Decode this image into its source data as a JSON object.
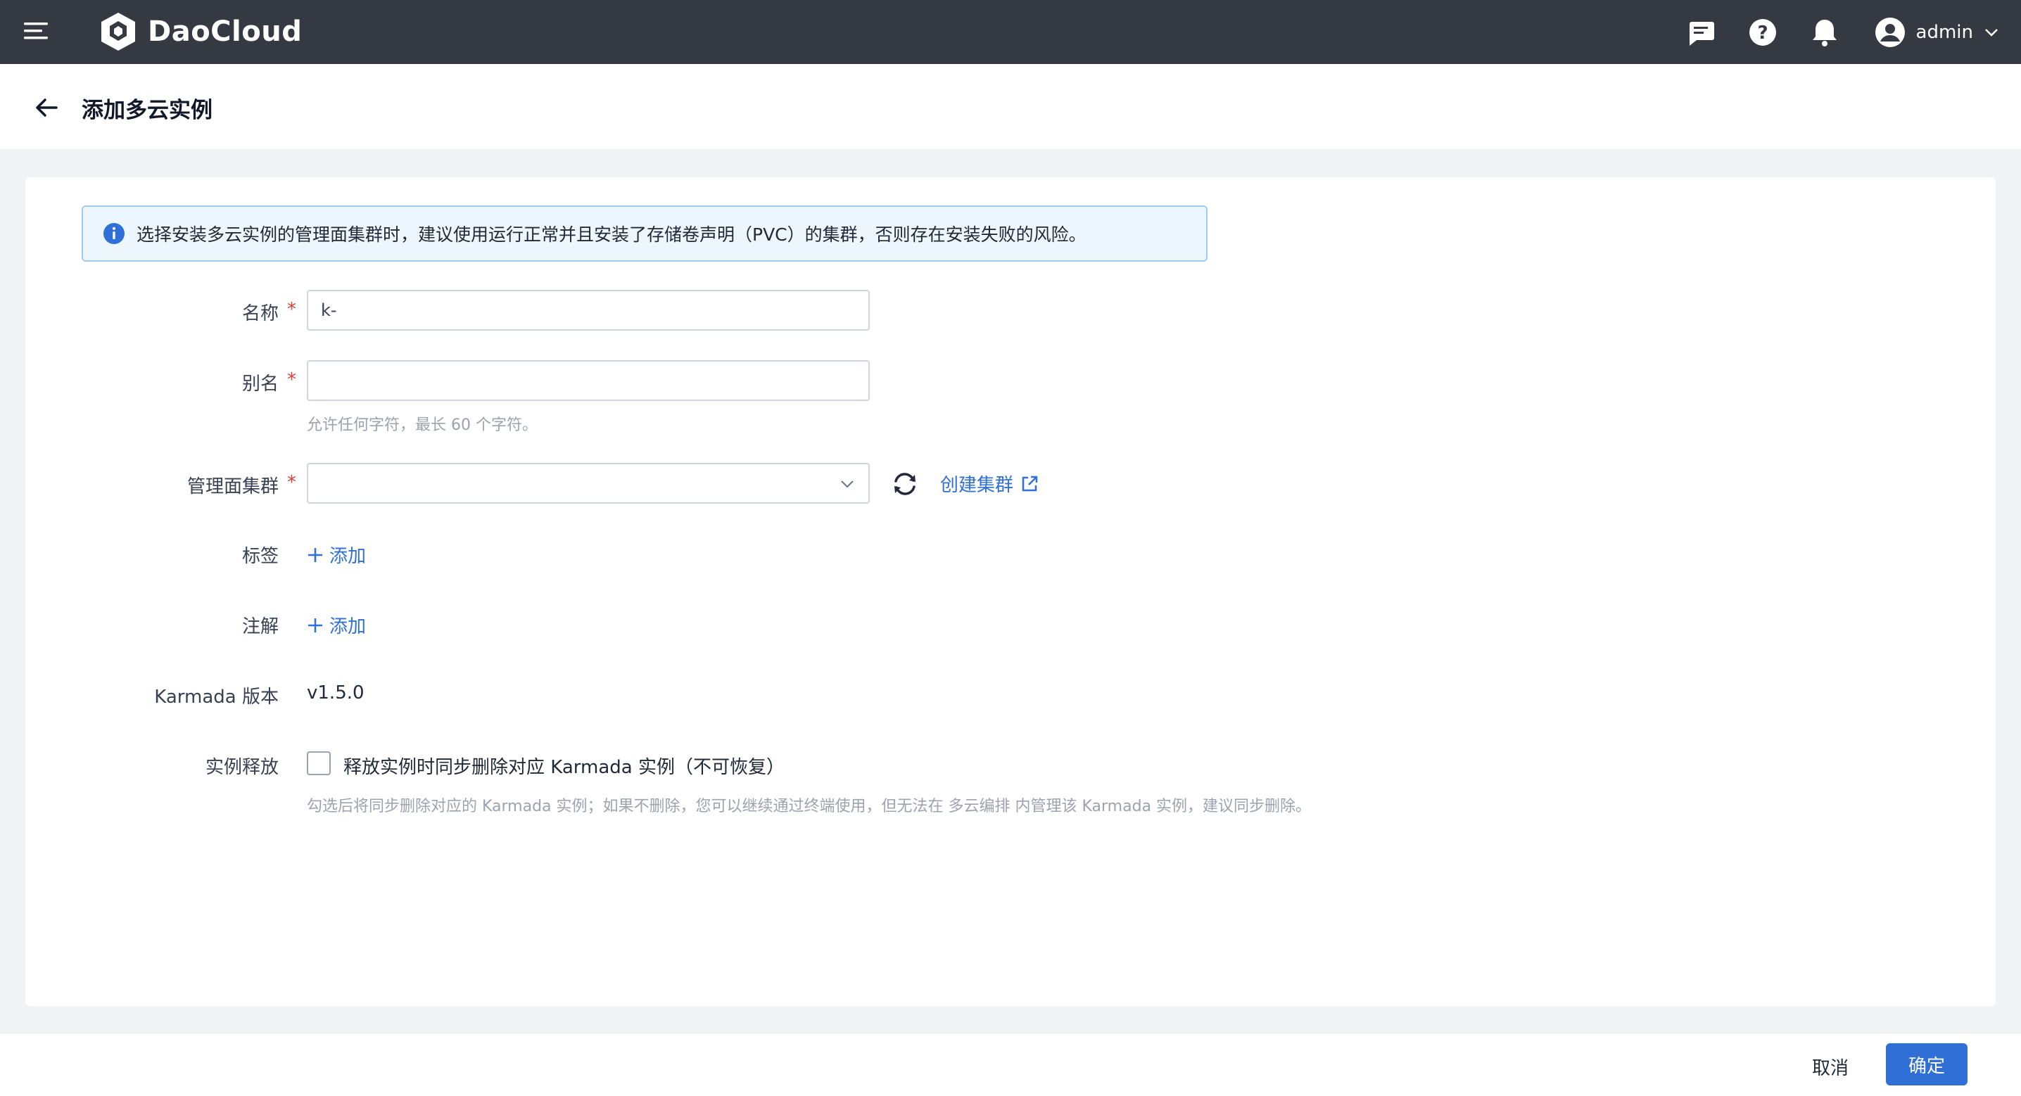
{
  "navbar": {
    "brand": "DaoCloud",
    "user_name": "admin",
    "icons": [
      "menu-icon",
      "message-icon",
      "help-icon",
      "bell-icon",
      "user-avatar-icon",
      "chevron-down-icon"
    ]
  },
  "page": {
    "title": "添加多云实例"
  },
  "alert": {
    "text": "选择安装多云实例的管理面集群时，建议使用运行正常并且安装了存储卷声明（PVC）的集群，否则存在安装失败的风险。"
  },
  "form": {
    "name": {
      "label": "名称",
      "required": "*",
      "value": "k-"
    },
    "alias": {
      "label": "别名",
      "required": "*",
      "value": "",
      "hint": "允许任何字符，最长 60 个字符。"
    },
    "cluster": {
      "label": "管理面集群",
      "required": "*",
      "value": "",
      "create_link": "创建集群"
    },
    "labels": {
      "label": "标签",
      "add": "添加"
    },
    "annotations": {
      "label": "注解",
      "add": "添加"
    },
    "karmada_version": {
      "label": "Karmada 版本",
      "value": "v1.5.0"
    },
    "release": {
      "label": "实例释放",
      "checkbox_label": "释放实例时同步删除对应 Karmada 实例（不可恢复）",
      "checked": false,
      "hint": "勾选后将同步删除对应的 Karmada 实例；如果不删除，您可以继续通过终端使用，但无法在 多云编排 内管理该 Karmada 实例，建议同步删除。"
    }
  },
  "footer": {
    "cancel": "取消",
    "confirm": "确定"
  },
  "colors": {
    "navbar_bg": "#353a42",
    "primary": "#2f6fd6",
    "required": "#e03b3b",
    "alert_bg": "#eef6fd",
    "alert_border": "#9fcbf2"
  }
}
